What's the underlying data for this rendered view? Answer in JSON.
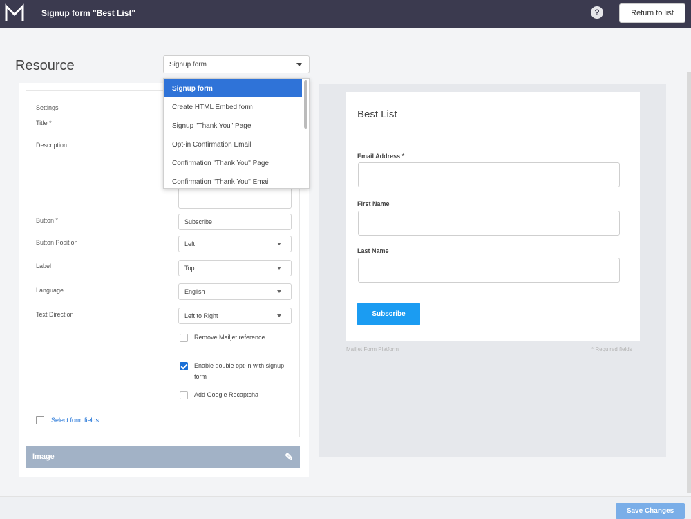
{
  "header": {
    "title": "Signup form \"Best List\"",
    "help_symbol": "?",
    "return_label": "Return to list"
  },
  "resource": {
    "label": "Resource",
    "selected": "Signup form",
    "options": [
      "Signup form",
      "Create HTML Embed form",
      "Signup \"Thank You\" Page",
      "Opt-in Confirmation Email",
      "Confirmation \"Thank You\" Page",
      "Confirmation \"Thank You\" Email"
    ]
  },
  "form_settings": {
    "settings_label": "Settings",
    "title_label": "Title *",
    "description_label": "Description",
    "button_label": "Button *",
    "button_value": "Subscribe",
    "button_position_label": "Button Position",
    "button_position_value": "Left",
    "label_label": "Label",
    "label_value": "Top",
    "language_label": "Language",
    "language_value": "English",
    "text_direction_label": "Text Direction",
    "text_direction_value": "Left to Right",
    "checkbox_remove": "Remove Mailjet reference",
    "checkbox_double_optin": "Enable double opt-in with signup form",
    "checkbox_recaptcha": "Add Google Recaptcha",
    "select_fields_link": "Select form fields",
    "image_section": "Image"
  },
  "preview": {
    "title": "Best List",
    "email_label": "Email Address *",
    "first_name_label": "First Name",
    "last_name_label": "Last Name",
    "subscribe_label": "Subscribe",
    "footer_left": "Mailjet Form Platform",
    "footer_right": "* Required fields"
  },
  "footer": {
    "save_label": "Save Changes"
  },
  "colors": {
    "topbar": "#3b3a4f",
    "accent": "#2f73d8",
    "subscribe": "#1b9cf2",
    "image_bar": "#a2b2c6"
  }
}
